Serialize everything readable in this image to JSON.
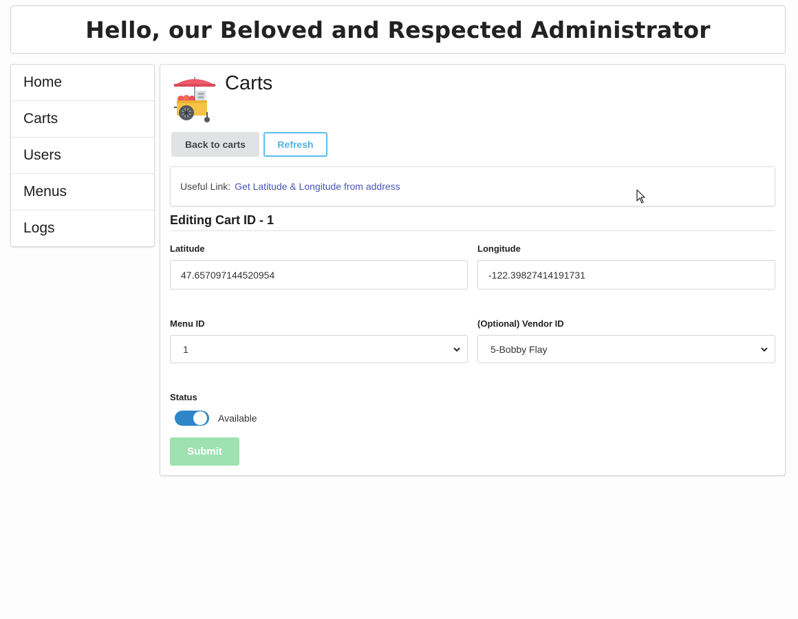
{
  "header": {
    "title": "Hello, our Beloved and Respected Administrator"
  },
  "sidebar": {
    "items": [
      {
        "label": "Home"
      },
      {
        "label": "Carts"
      },
      {
        "label": "Users"
      },
      {
        "label": "Menus"
      },
      {
        "label": "Logs"
      }
    ]
  },
  "page": {
    "title": "Carts",
    "icon": "food-cart-icon",
    "back_label": "Back to carts",
    "refresh_label": "Refresh"
  },
  "useful": {
    "label": "Useful Link:",
    "link_text": "Get Latitude & Longitude from address"
  },
  "form": {
    "title": "Editing Cart ID - 1",
    "latitude": {
      "label": "Latitude",
      "value": "47.657097144520954"
    },
    "longitude": {
      "label": "Longitude",
      "value": "-122.39827414191731"
    },
    "menu_id": {
      "label": "Menu ID",
      "selected": "1"
    },
    "vendor_id": {
      "label": "(Optional) Vendor ID",
      "selected": "5-Bobby Flay"
    },
    "status": {
      "label": "Status",
      "toggle_label": "Available",
      "on": true
    },
    "submit_label": "Submit"
  },
  "colors": {
    "refresh": "#5bbcec",
    "link": "#4a53b8",
    "toggle_on": "#2c86c7",
    "submit_disabled": "#9de2b0"
  }
}
